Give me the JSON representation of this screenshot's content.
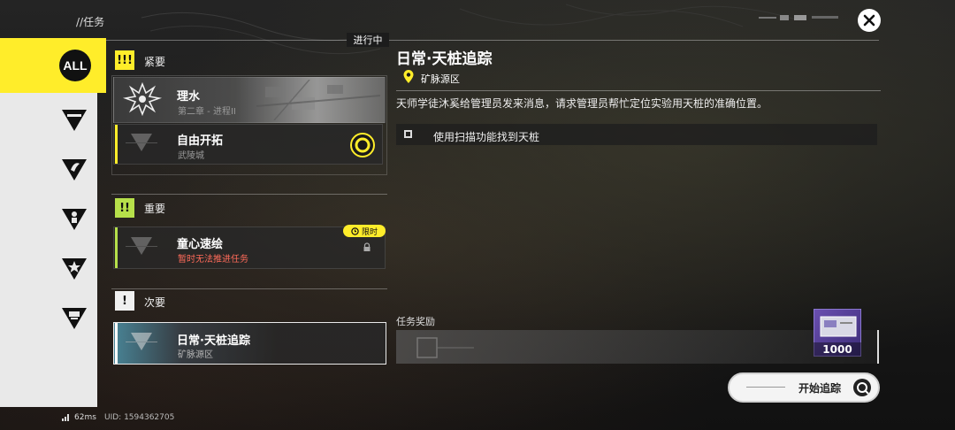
{
  "header": {
    "title": "//任务",
    "status_tab": "进行中"
  },
  "sidebar": {
    "all_label": "ALL",
    "icons": [
      "endfield-icon",
      "wing-icon",
      "person-icon",
      "star-icon",
      "vehicle-icon"
    ]
  },
  "sections": [
    {
      "badge": "!!!",
      "label": "紧要"
    },
    {
      "badge": "!!",
      "label": "重要"
    },
    {
      "badge": "!",
      "label": "次要"
    }
  ],
  "quests": {
    "urgent_main": {
      "title": "理水",
      "subtitle": "第二章 - 进程II"
    },
    "urgent_free": {
      "title": "自由开拓",
      "subtitle": "武陵城"
    },
    "important": {
      "title": "童心速绘",
      "subtitle": "暂时无法推进任务",
      "tag": "限时"
    },
    "minor": {
      "title": "日常·天桩追踪",
      "subtitle": "矿脉源区"
    }
  },
  "detail": {
    "title": "日常·天桩追踪",
    "location": "矿脉源区",
    "description": "天师学徒沐奚给管理员发来消息，请求管理员帮忙定位实验用天桩的准确位置。",
    "objective": "使用扫描功能找到天桩",
    "reward_label": "任务奖励",
    "reward_count": "1000",
    "track_button": "开始追踪"
  },
  "footer": {
    "ping": "62ms",
    "uid": "UID: 1594362705"
  },
  "colors": {
    "accent_yellow": "#ffed2a",
    "important_green": "#b6e04a",
    "warning_red": "#ff6b5a",
    "selected_cyan": "#5bb8d6"
  }
}
